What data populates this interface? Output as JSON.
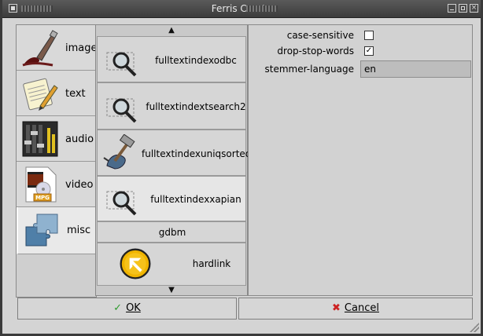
{
  "window": {
    "title": "Ferris Create"
  },
  "categories": [
    {
      "label": "image",
      "icon": "paintbrush-icon",
      "active": false
    },
    {
      "label": "text",
      "icon": "notepad-icon",
      "active": false
    },
    {
      "label": "audio",
      "icon": "mixer-icon",
      "active": false
    },
    {
      "label": "video",
      "icon": "mpeg-video-icon",
      "active": false
    },
    {
      "label": "misc",
      "icon": "puzzle-icon",
      "active": true
    }
  ],
  "plugins": [
    {
      "label": "fulltextindexodbc",
      "icon": "magnifier-folder-icon",
      "selected": false
    },
    {
      "label": "fulltextindextsearch2",
      "icon": "magnifier-folder-icon",
      "selected": false
    },
    {
      "label": "fulltextindexuniqsorted",
      "icon": "hammer-tool-icon",
      "selected": false
    },
    {
      "label": "fulltextindexxapian",
      "icon": "magnifier-folder-icon",
      "selected": true
    },
    {
      "label": "gdbm",
      "icon": "",
      "selected": false
    },
    {
      "label": "hardlink",
      "icon": "link-arrow-icon",
      "selected": false
    }
  ],
  "scroll": {
    "up": "▲",
    "down": "▼"
  },
  "properties": {
    "case_sensitive": {
      "label": "case-sensitive",
      "checked": false
    },
    "drop_stop_words": {
      "label": "drop-stop-words",
      "checked": true,
      "mark": "✓"
    },
    "stemmer_language": {
      "label": "stemmer-language",
      "value": "en"
    }
  },
  "buttons": {
    "ok": {
      "label": "OK",
      "glyph": "✓"
    },
    "cancel": {
      "label": "Cancel",
      "glyph": "✖"
    }
  }
}
